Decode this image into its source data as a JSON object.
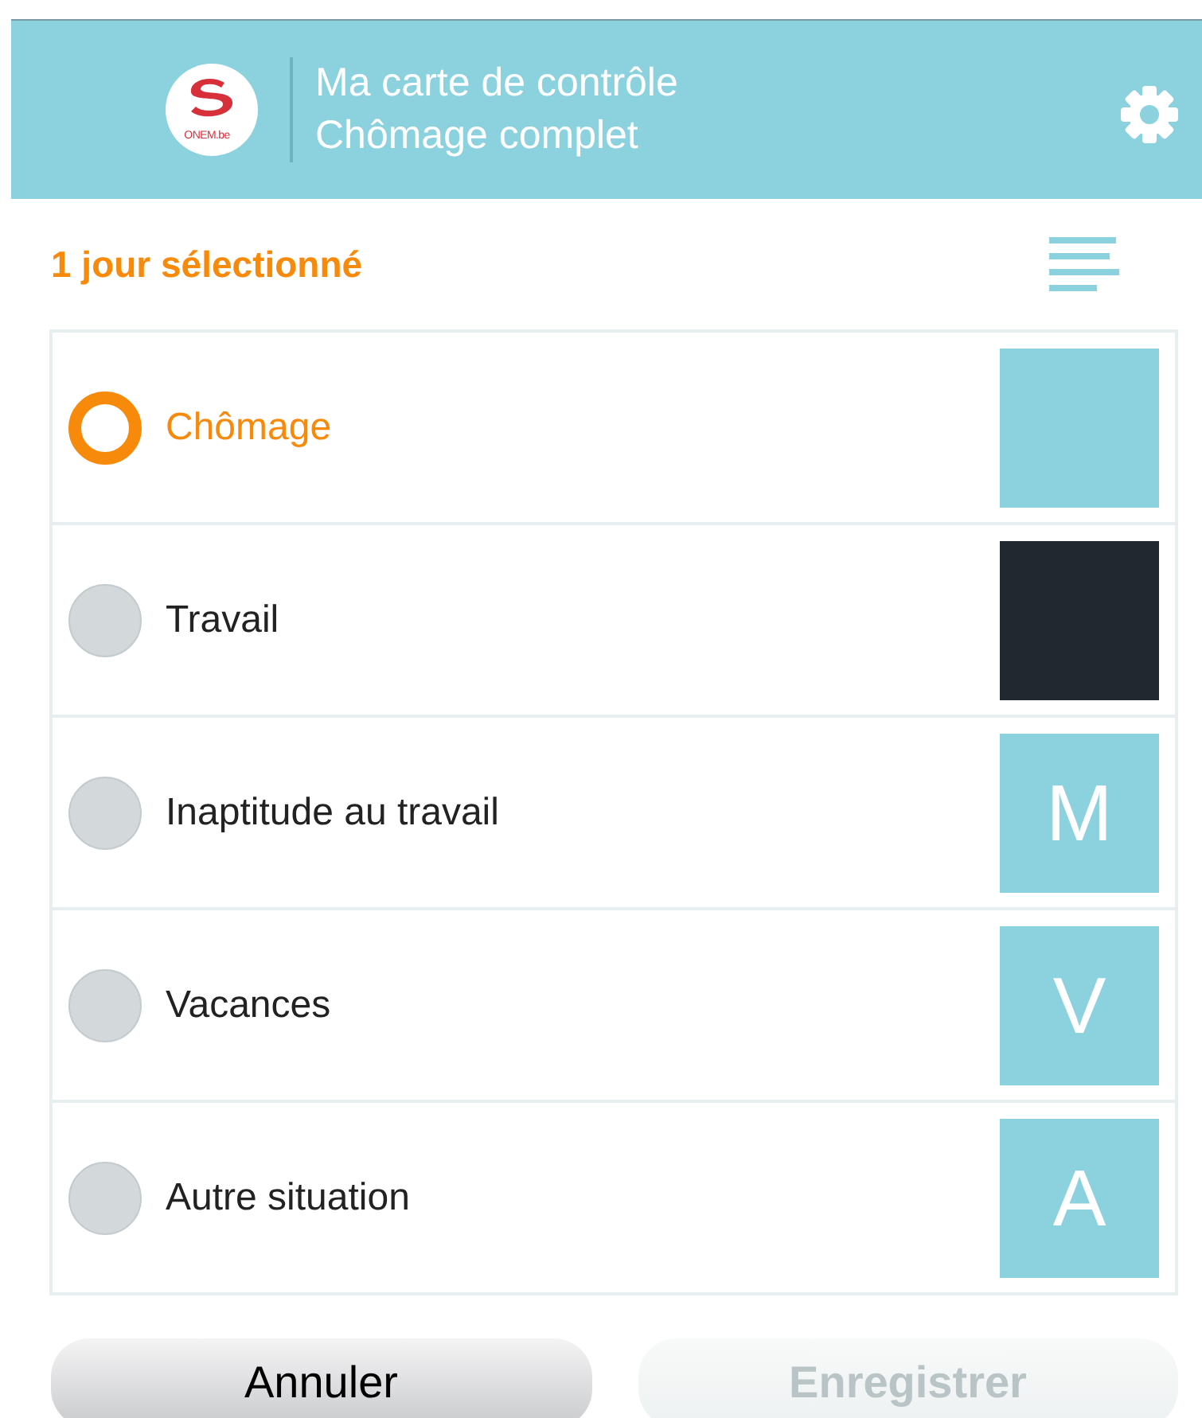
{
  "header": {
    "logo_text": "ONEM.be",
    "title": "Ma carte de contrôle",
    "subtitle": "Chômage complet"
  },
  "selection_summary": "1 jour sélectionné",
  "options": [
    {
      "label": "Chômage",
      "selected": true,
      "color": "#8bd1de"
    },
    {
      "label": "Travail",
      "selected": false,
      "color": "#22292e"
    },
    {
      "label": "Inaptitude au travail",
      "selected": false,
      "color": "#8bd1de",
      "code": "M"
    },
    {
      "label": "Vacances",
      "selected": false,
      "color": "#8bd1de",
      "code": "V"
    },
    {
      "label": "Autre situation",
      "selected": false,
      "color": "#8bd1de",
      "code": "A"
    }
  ],
  "buttons": [
    {
      "label": "Annuler",
      "disabled": false
    },
    {
      "label": "Enregistrer",
      "disabled": true
    }
  ]
}
